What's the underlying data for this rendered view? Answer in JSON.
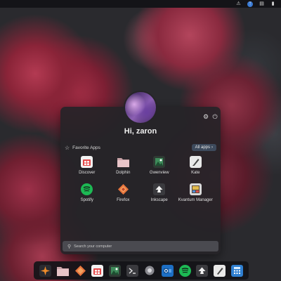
{
  "topbar": {
    "icons": [
      "notifications-icon",
      "bluetooth-icon",
      "clipboard-icon",
      "battery-icon"
    ]
  },
  "menu": {
    "greeting": "Hi, zaron",
    "settings_icon": "gear-icon",
    "power_icon": "power-icon",
    "favorites_label": "Favorite Apps",
    "all_apps_label": "All apps",
    "apps": [
      {
        "label": "Discover",
        "icon": "discover-icon"
      },
      {
        "label": "Dolphin",
        "icon": "folder-icon"
      },
      {
        "label": "Gwenview",
        "icon": "gwenview-icon"
      },
      {
        "label": "Kate",
        "icon": "kate-icon"
      },
      {
        "label": "Spotify",
        "icon": "spotify-icon"
      },
      {
        "label": "Firefox",
        "icon": "firefox-icon"
      },
      {
        "label": "Inkscape",
        "icon": "inkscape-icon"
      },
      {
        "label": "Kvantum Manager",
        "icon": "kvantum-icon"
      }
    ],
    "search_placeholder": "Search your computer"
  },
  "dock": {
    "items": [
      "kde-launcher-icon",
      "dolphin-icon",
      "firefox-icon",
      "discover-icon",
      "gwenview-icon",
      "terminal-icon",
      "settings-icon",
      "outlook-icon",
      "spotify-icon",
      "inkscape-icon",
      "kate-icon",
      "calculator-icon"
    ]
  },
  "colors": {
    "accent": "#3d4a5c",
    "panel": "#262428",
    "search": "#4a4a50"
  }
}
